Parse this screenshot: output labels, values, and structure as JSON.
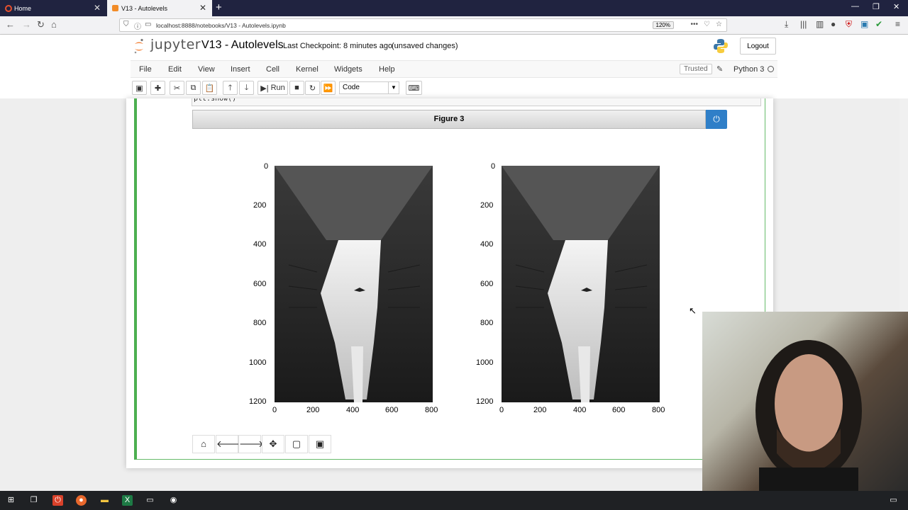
{
  "browser": {
    "tabs": [
      {
        "title": "Home",
        "active": false
      },
      {
        "title": "V13 - Autolevels",
        "active": true
      }
    ],
    "url": "localhost:8888/notebooks/V13 - Autolevels.ipynb",
    "zoom": "120%"
  },
  "jupyter": {
    "logo_text": "jupyter",
    "notebook_title": "V13 - Autolevels",
    "checkpoint": "Last Checkpoint: 8 minutes ago",
    "unsaved": "(unsaved changes)",
    "logout_label": "Logout",
    "menu": [
      "File",
      "Edit",
      "View",
      "Insert",
      "Cell",
      "Kernel",
      "Widgets",
      "Help"
    ],
    "trusted_label": "Trusted",
    "kernel_name": "Python 3",
    "toolbar": {
      "run_label": "Run",
      "cell_type": "Code"
    }
  },
  "cell": {
    "code_tail": "plt.show()"
  },
  "figure": {
    "title": "Figure 3"
  },
  "chart_data": [
    {
      "type": "image",
      "x_ticks": [
        "0",
        "200",
        "400",
        "600",
        "800"
      ],
      "y_ticks": [
        "0",
        "200",
        "400",
        "600",
        "800",
        "1000",
        "1200"
      ],
      "xlim": [
        0,
        800
      ],
      "ylim": [
        1200,
        0
      ]
    },
    {
      "type": "image",
      "x_ticks": [
        "0",
        "200",
        "400",
        "600",
        "800"
      ],
      "y_ticks": [
        "0",
        "200",
        "400",
        "600",
        "800",
        "1000",
        "1200"
      ],
      "xlim": [
        0,
        800
      ],
      "ylim": [
        1200,
        0
      ]
    }
  ],
  "colors": {
    "accent": "#2f7fc8",
    "cell_border": "#4caf50",
    "tabbar": "#202340"
  }
}
